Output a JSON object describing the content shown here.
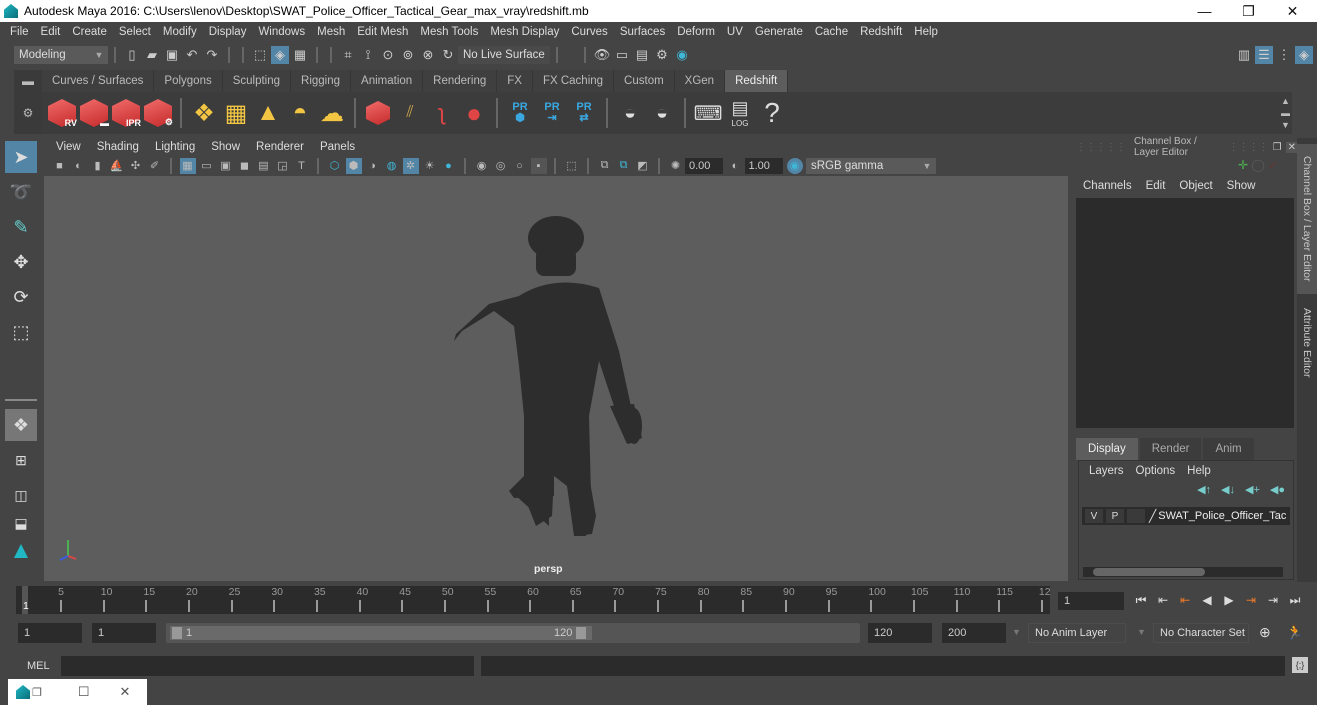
{
  "window": {
    "title": "Autodesk Maya 2016: C:\\Users\\lenov\\Desktop\\SWAT_Police_Officer_Tactical_Gear_max_vray\\redshift.mb",
    "minimize": "—",
    "restore": "❐",
    "close": "✕"
  },
  "menubar": [
    "File",
    "Edit",
    "Create",
    "Select",
    "Modify",
    "Display",
    "Windows",
    "Mesh",
    "Edit Mesh",
    "Mesh Tools",
    "Mesh Display",
    "Curves",
    "Surfaces",
    "Deform",
    "UV",
    "Generate",
    "Cache",
    "Redshift",
    "Help"
  ],
  "status": {
    "mode": "Modeling",
    "live_surface": "No Live Surface"
  },
  "shelf": {
    "tabs": [
      "Curves / Surfaces",
      "Polygons",
      "Sculpting",
      "Rigging",
      "Animation",
      "Rendering",
      "FX",
      "FX Caching",
      "Custom",
      "XGen",
      "Redshift"
    ],
    "active_tab": "Redshift",
    "labels": {
      "rv": "RV",
      "ipr": "IPR",
      "pr": "PR",
      "log": "LOG",
      "help": "?"
    }
  },
  "panel": {
    "menu": [
      "View",
      "Shading",
      "Lighting",
      "Show",
      "Renderer",
      "Panels"
    ],
    "exposure": "0.00",
    "gamma": "1.00",
    "color_space": "sRGB gamma",
    "camera_label": "persp"
  },
  "channel_box": {
    "title": "Channel Box / Layer Editor",
    "menu": [
      "Channels",
      "Edit",
      "Object",
      "Show"
    ],
    "side_tabs": [
      "Channel Box / Layer Editor",
      "Attribute Editor"
    ]
  },
  "layer_editor": {
    "tabs": [
      "Display",
      "Render",
      "Anim"
    ],
    "active_tab": "Display",
    "menu": [
      "Layers",
      "Options",
      "Help"
    ],
    "layers": [
      {
        "visible": "V",
        "playback": "P",
        "name": "SWAT_Police_Officer_Tac"
      }
    ]
  },
  "timeline": {
    "start_label": "1",
    "ticks": [
      "5",
      "10",
      "15",
      "20",
      "25",
      "30",
      "35",
      "40",
      "45",
      "50",
      "55",
      "60",
      "65",
      "70",
      "75",
      "80",
      "85",
      "90",
      "95",
      "100",
      "105",
      "110",
      "115",
      "12"
    ],
    "current_frame": "1"
  },
  "range": {
    "start": "1",
    "playback_start": "1",
    "slider_start": "1",
    "slider_end": "120",
    "playback_end": "120",
    "end": "200",
    "anim_layer": "No Anim Layer",
    "character_set": "No Character Set"
  },
  "command": {
    "language": "MEL"
  },
  "colors": {
    "accent": "#5285a6",
    "redshift_red": "#e04545",
    "shelf_yellow": "#f2c542",
    "pr_blue": "#3aa7e0",
    "keyframe_orange": "#e8782a"
  }
}
